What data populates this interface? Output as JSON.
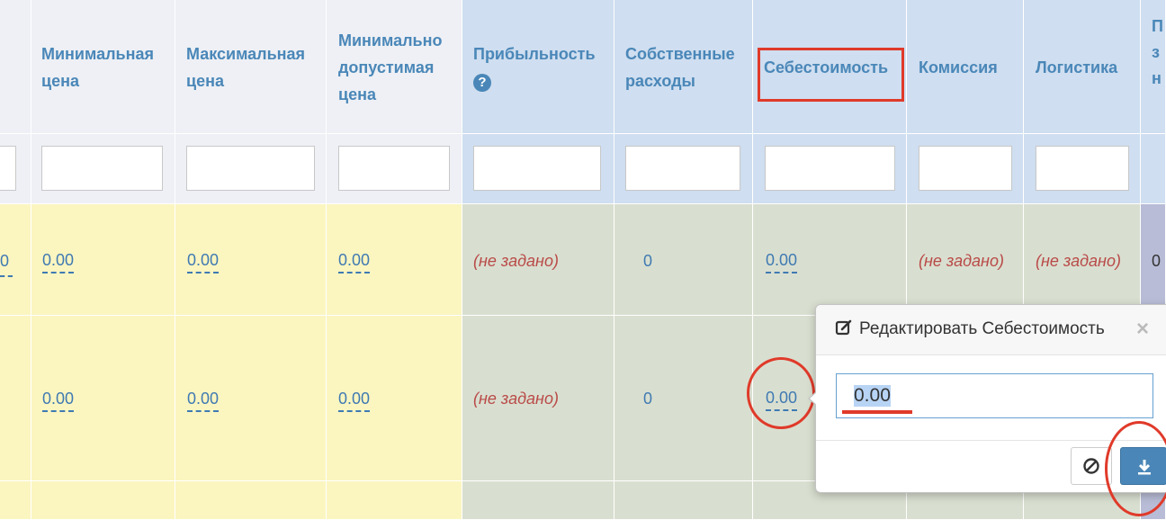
{
  "headers": {
    "min_price": "Минимальная цена",
    "max_price": "Максимальная цена",
    "min_allowed_price": "Минимально допустимая цена",
    "profitability": "Прибыльность",
    "own_expenses": "Собственные расходы",
    "cost_price": "Себестоимость",
    "commission": "Комиссия",
    "logistics": "Логистика",
    "partial_edge": "П з н"
  },
  "rows": [
    {
      "partial_left": "0",
      "min_price": "0.00",
      "max_price": "0.00",
      "min_allowed_price": "0.00",
      "profitability": "(не задано)",
      "own_expenses": "0",
      "cost_price": "0.00",
      "commission": "(не задано)",
      "logistics": "(не задано)",
      "partial_right": "0"
    },
    {
      "min_price": "0.00",
      "max_price": "0.00",
      "min_allowed_price": "0.00",
      "profitability": "(не задано)",
      "own_expenses": "0",
      "cost_price": "0.00"
    }
  ],
  "popover": {
    "title": "Редактировать Себестоимость",
    "input_value": "0.00",
    "close_glyph": "×",
    "cancel_icon": "ban-icon",
    "save_icon": "download-icon"
  },
  "colors": {
    "header_link": "#4a87b8",
    "not_set": "#b94a48",
    "annotation_red": "#e03a2a",
    "save_button": "#4a87b8"
  }
}
